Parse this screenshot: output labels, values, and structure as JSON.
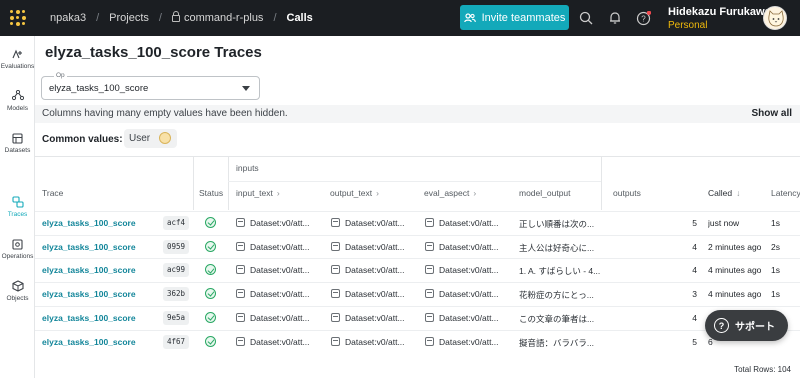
{
  "breadcrumb": {
    "entity": "npaka3",
    "projects": "Projects",
    "project": "command-r-plus",
    "page": "Calls",
    "separator": "/"
  },
  "header": {
    "invite_label": "Invite teammates",
    "user_name": "Hidekazu Furukawa",
    "user_plan": "Personal"
  },
  "sidebar": {
    "items": [
      {
        "label": "Evaluations",
        "icon": "evaluations-icon"
      },
      {
        "label": "Models",
        "icon": "models-icon"
      },
      {
        "label": "Datasets",
        "icon": "datasets-icon"
      },
      {
        "label": "Traces",
        "icon": "traces-icon",
        "active": true
      },
      {
        "label": "Operations",
        "icon": "operations-icon"
      },
      {
        "label": "Objects",
        "icon": "objects-icon"
      }
    ]
  },
  "main": {
    "title": "elyza_tasks_100_score Traces",
    "op_label": "Op",
    "op_value": "elyza_tasks_100_score",
    "banner_message": "Columns having many empty values have been hidden.",
    "show_all": "Show all",
    "common_values_label": "Common values:",
    "common_chip": "User"
  },
  "table": {
    "group_header": "inputs",
    "columns": {
      "trace": "Trace",
      "status": "Status",
      "input_text": "input_text",
      "output_text": "output_text",
      "eval_aspect": "eval_aspect",
      "model_output": "model_output",
      "outputs": "outputs",
      "called": "Called",
      "latency": "Latency"
    },
    "rows": [
      {
        "trace": "elyza_tasks_100_score",
        "hash": "acf4",
        "input_text": "Dataset:v0/att...",
        "output_text": "Dataset:v0/att...",
        "eval_aspect": "Dataset:v0/att...",
        "model_output": "正しい順番は次の...",
        "outputs": "5",
        "called": "just now",
        "latency": "1s"
      },
      {
        "trace": "elyza_tasks_100_score",
        "hash": "0959",
        "input_text": "Dataset:v0/att...",
        "output_text": "Dataset:v0/att...",
        "eval_aspect": "Dataset:v0/att...",
        "model_output": "主人公は好奇心に...",
        "outputs": "4",
        "called": "2 minutes ago",
        "latency": "2s"
      },
      {
        "trace": "elyza_tasks_100_score",
        "hash": "ac99",
        "input_text": "Dataset:v0/att...",
        "output_text": "Dataset:v0/att...",
        "eval_aspect": "Dataset:v0/att...",
        "model_output": "1. A. すばらしい - 4...",
        "outputs": "4",
        "called": "4 minutes ago",
        "latency": "1s"
      },
      {
        "trace": "elyza_tasks_100_score",
        "hash": "362b",
        "input_text": "Dataset:v0/att...",
        "output_text": "Dataset:v0/att...",
        "eval_aspect": "Dataset:v0/att...",
        "model_output": "花粉症の方にとっ...",
        "outputs": "3",
        "called": "4 minutes ago",
        "latency": "1s"
      },
      {
        "trace": "elyza_tasks_100_score",
        "hash": "9e5a",
        "input_text": "Dataset:v0/att...",
        "output_text": "Dataset:v0/att...",
        "eval_aspect": "Dataset:v0/att...",
        "model_output": "この文章の筆者は...",
        "outputs": "4",
        "called": "5",
        "latency": ""
      },
      {
        "trace": "elyza_tasks_100_score",
        "hash": "4f67",
        "input_text": "Dataset:v0/att...",
        "output_text": "Dataset:v0/att...",
        "eval_aspect": "Dataset:v0/att...",
        "model_output": "擬音語：バラバラ...",
        "outputs": "5",
        "called": "6",
        "latency": ""
      }
    ],
    "total_rows": "Total Rows: 104"
  },
  "support_label": "サポート",
  "colors": {
    "accent": "#13a9ba",
    "topbar": "#1b1e22",
    "link": "#13869a",
    "success": "#2aa864",
    "plan": "#f0b90b"
  }
}
